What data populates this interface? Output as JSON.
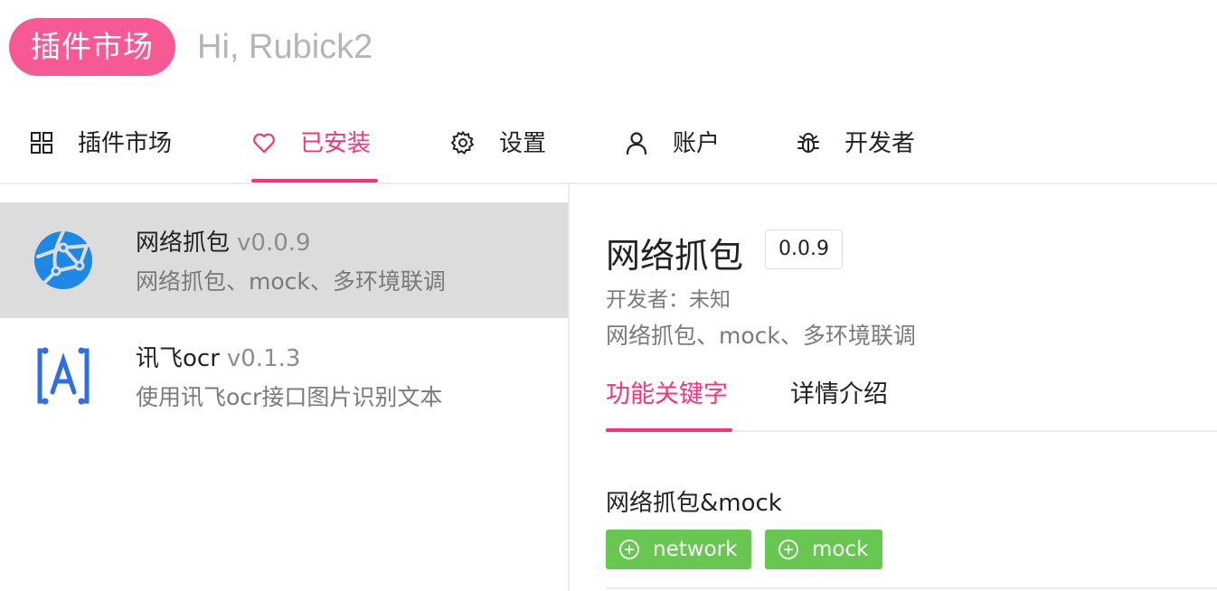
{
  "header": {
    "logo_label": "插件市场",
    "greeting": "Hi, Rubick2"
  },
  "nav": {
    "items": [
      {
        "label": "插件市场",
        "icon": "grid-icon"
      },
      {
        "label": "已安装",
        "icon": "heart-icon",
        "active": true
      },
      {
        "label": "设置",
        "icon": "gear-icon"
      },
      {
        "label": "账户",
        "icon": "user-icon"
      },
      {
        "label": "开发者",
        "icon": "bug-icon"
      }
    ]
  },
  "plugins": [
    {
      "name": "网络抓包",
      "version": "v0.0.9",
      "desc": "网络抓包、mock、多环境联调",
      "icon": "network-globe-icon",
      "selected": true
    },
    {
      "name": "讯飞ocr",
      "version": "v0.1.3",
      "desc": "使用讯飞ocr接口图片识别文本",
      "icon": "ocr-a-icon"
    }
  ],
  "detail": {
    "title": "网络抓包",
    "version": "0.0.9",
    "developer": "开发者：未知",
    "desc": "网络抓包、mock、多环境联调",
    "tabs": [
      {
        "label": "功能关键字",
        "active": true
      },
      {
        "label": "详情介绍"
      }
    ],
    "feature_title": "网络抓包&mock",
    "keywords": [
      "network",
      "mock"
    ]
  },
  "colors": {
    "accent": "#f5357b",
    "logo_bg": "#f75995",
    "tag_green": "#67c750",
    "selected_row": "#dcdcdc"
  }
}
